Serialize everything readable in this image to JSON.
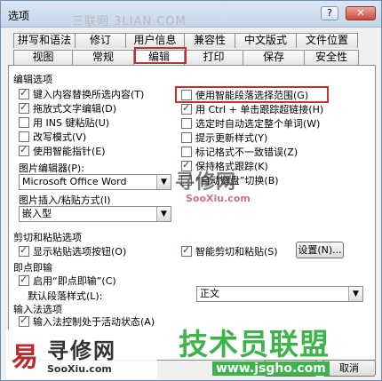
{
  "window": {
    "title": "选项",
    "help_label": "?",
    "close_label": "✕",
    "watermark_top": "三联网 3LIAN.COM"
  },
  "tabs_row1": [
    "拼写和语法",
    "修订",
    "用户信息",
    "兼容性",
    "中文版式",
    "文件位置"
  ],
  "tabs_row2": [
    "视图",
    "常规",
    "编辑",
    "打印",
    "保存",
    "安全性"
  ],
  "selected_tab": "编辑",
  "editing": {
    "section_title": "编辑选项",
    "left": [
      {
        "label": "键入内容替换所选内容(T)",
        "checked": true
      },
      {
        "label": "拖放式文字编辑(D)",
        "checked": true
      },
      {
        "label": "用 INS 键粘贴(U)",
        "checked": false
      },
      {
        "label": "改写模式(V)",
        "checked": false
      },
      {
        "label": "使用智能指针(E)",
        "checked": true
      }
    ],
    "right": [
      {
        "label": "使用智能段落选择范围(G)",
        "checked": false
      },
      {
        "label": "用 Ctrl + 单击跟踪超链接(H)",
        "checked": true
      },
      {
        "label": "选定时自动选定整个单词(W)",
        "checked": false
      },
      {
        "label": "提示更新样式(Y)",
        "checked": false
      },
      {
        "label": "标记格式不一致错误(Z)",
        "checked": false
      },
      {
        "label": "保持格式跟踪(K)",
        "checked": true
      },
      {
        "label": "“自动键盘”切换(B)",
        "checked": false
      }
    ],
    "picture_editor_label": "图片编辑器(P):",
    "picture_editor_value": "Microsoft Office Word",
    "insert_paste_label": "图片插入/粘贴方式(I)",
    "insert_paste_value": "嵌入型"
  },
  "cut_paste": {
    "section_title": "剪切和粘贴选项",
    "show_paste_buttons": {
      "label": "显示粘贴选项按钮(O)",
      "checked": true
    },
    "smart_cut_paste": {
      "label": "智能剪切和粘贴(S)",
      "checked": true
    },
    "settings_label": "设置(N)..."
  },
  "click_type": {
    "section_title": "即点即输",
    "enable": {
      "label": "启用“即点即输”(C)",
      "checked": true
    },
    "default_style_label": "默认段落样式(L):",
    "default_style_value": "正文"
  },
  "ime": {
    "section_title": "输入法选项",
    "ime_control": {
      "label": "输入法控制处于活动状态(A)",
      "checked": true
    }
  },
  "footer": {
    "ok_label": "确定",
    "cancel_label": "取消"
  },
  "watermarks": {
    "left_mark": "易",
    "left_name": "寻修网",
    "left_url": "SooXiu.com",
    "right_name": "技术员联盟",
    "right_url": "www.jsgho.com",
    "mid_name": "寻修网",
    "mid_url": "SooXiu.com"
  }
}
